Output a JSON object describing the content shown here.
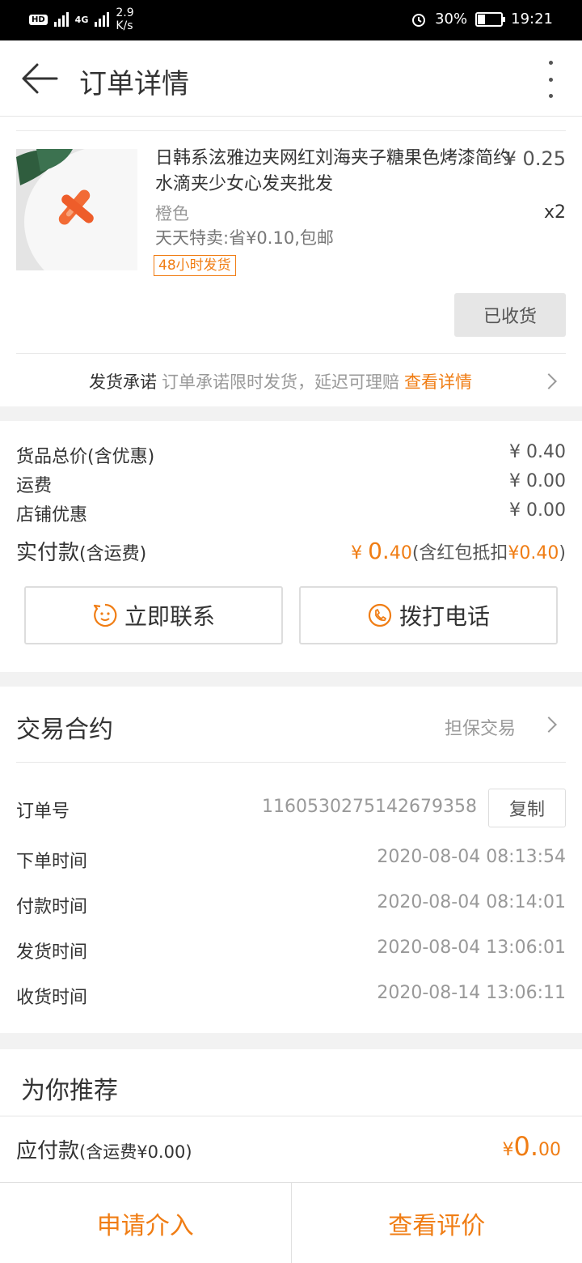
{
  "status_bar": {
    "hd": "HD",
    "network": "4G",
    "speed_value": "2.9",
    "speed_unit": "K/s",
    "battery": "30%",
    "battery_level": 0.3,
    "time": "19:21"
  },
  "header": {
    "title": "订单详情"
  },
  "product": {
    "name": "日韩系泫雅边夹网红刘海夹子糖果色烤漆简约水滴夹少女心发夹批发",
    "price": "¥ 0.25",
    "spec": "橙色",
    "qty": "x2",
    "promo": "天天特卖:省¥0.10,包邮",
    "tag": "48小时发货",
    "status_button": "已收货"
  },
  "promise": {
    "key": "发货承诺",
    "text": "订单承诺限时发货，延迟可理赔",
    "link": "查看详情"
  },
  "summary": {
    "rows": [
      {
        "label": "货品总价(含优惠)",
        "value": "¥ 0.40"
      },
      {
        "label": "运费",
        "value": "¥ 0.00"
      },
      {
        "label": "店铺优惠",
        "value": "¥ 0.00"
      }
    ],
    "paid_label": "实付款",
    "paid_label_note": "(含运费)",
    "paid_symbol": "¥ ",
    "paid_int": "0.",
    "paid_dec": "40",
    "paid_note_pre": "(含红包抵扣",
    "paid_note_amount": "¥0.40",
    "paid_note_post": ")",
    "contact_button": "立即联系",
    "call_button": "拨打电话"
  },
  "contract": {
    "title": "交易合约",
    "type": "担保交易",
    "order_no_label": "订单号",
    "order_no": "1160530275142679358",
    "copy_button": "复制",
    "times": [
      {
        "label": "下单时间",
        "value": "2020-08-04 08:13:54"
      },
      {
        "label": "付款时间",
        "value": "2020-08-04 08:14:01"
      },
      {
        "label": "发货时间",
        "value": "2020-08-04 13:06:01"
      },
      {
        "label": "收货时间",
        "value": "2020-08-14 13:06:11"
      }
    ]
  },
  "recommend": {
    "title": "为你推荐"
  },
  "payable": {
    "label": "应付款",
    "note": "(含运费¥0.00)",
    "symbol": "¥",
    "int": "0.",
    "dec": "00"
  },
  "bottom_bar": {
    "left": "申请介入",
    "right": "查看评价"
  },
  "colors": {
    "accent": "#f07d14",
    "background": "#f2f2f2"
  },
  "icons": [
    "back-arrow-icon",
    "more-vertical-icon",
    "chevron-right-icon",
    "smile-chat-icon",
    "phone-icon"
  ]
}
